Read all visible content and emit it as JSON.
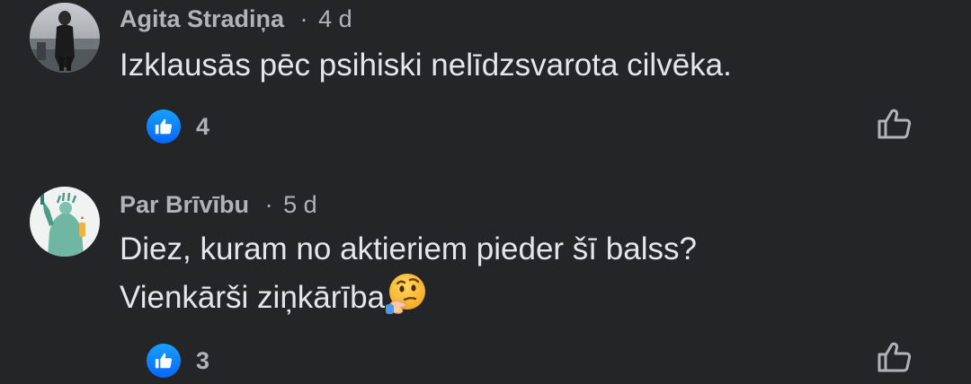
{
  "comments": [
    {
      "author": "Agita Stradiņa",
      "separator": "·",
      "time": "4 d",
      "lines": [
        "Izklausās pēc psihiski nelīdzsvarota cilvēka."
      ],
      "reaction_icon": "like-icon",
      "reaction_count": "4",
      "like_button_icon": "thumbs-up-outline-icon"
    },
    {
      "author": "Par Brīvību",
      "separator": "·",
      "time": "5 d",
      "lines": [
        "Diez, kuram no aktieriem pieder šī balss?",
        "Vienkārši ziņkārība"
      ],
      "trailing_emoji": "thinking-face-emoji",
      "reaction_icon": "like-icon",
      "reaction_count": "3",
      "like_button_icon": "thumbs-up-outline-icon"
    }
  ],
  "colors": {
    "background": "#242526",
    "text_primary": "#e4e6eb",
    "text_secondary": "#b0b3b8",
    "like_blue": "#0866ff"
  }
}
